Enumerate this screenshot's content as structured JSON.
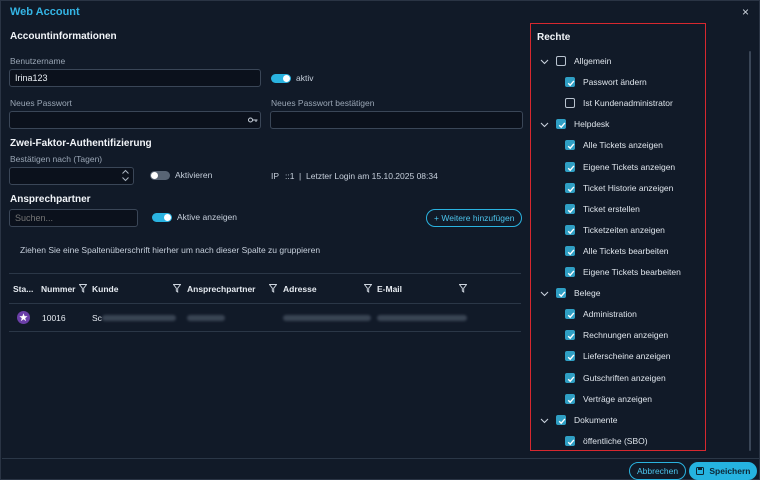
{
  "window": {
    "title": "Web Account",
    "close_glyph": "×"
  },
  "account": {
    "section_title": "Accountinformationen",
    "username_label": "Benutzername",
    "username_value": "Irina123",
    "active_label": "aktiv",
    "password_label": "Neues Passwort",
    "password_confirm_label": "Neues Passwort bestätigen"
  },
  "twofa": {
    "section_title": "Zwei-Faktor-Authentifizierung",
    "confirm_after_label": "Bestätigen nach (Tagen)",
    "activate_label": "Aktivieren",
    "ip_label": "IP",
    "ip_value": "::1",
    "separator": "|",
    "last_login": "Letzter Login am 15.10.2025 08:34"
  },
  "contacts": {
    "section_title": "Ansprechpartner",
    "search_placeholder": "Suchen...",
    "show_active_label": "Aktive anzeigen",
    "add_more_label": "Weitere hinzufügen",
    "add_icon": "+",
    "group_hint": "Ziehen Sie eine Spaltenüberschrift hierher um nach dieser Spalte zu gruppieren",
    "columns": [
      "Sta...",
      "Nummer",
      "Kunde",
      "Ansprechpartner",
      "Adresse",
      "E-Mail"
    ],
    "rows": [
      {
        "number": "10016",
        "customer_prefix": "Sc"
      }
    ]
  },
  "rights": {
    "title": "Rechte",
    "groups": [
      {
        "label": "Allgemein",
        "checked": false,
        "items": [
          {
            "label": "Passwort ändern",
            "checked": true
          },
          {
            "label": "Ist Kundenadministrator",
            "checked": false
          }
        ]
      },
      {
        "label": "Helpdesk",
        "checked": true,
        "items": [
          {
            "label": "Alle Tickets anzeigen",
            "checked": true
          },
          {
            "label": "Eigene Tickets anzeigen",
            "checked": true
          },
          {
            "label": "Ticket Historie anzeigen",
            "checked": true
          },
          {
            "label": "Ticket erstellen",
            "checked": true
          },
          {
            "label": "Ticketzeiten anzeigen",
            "checked": true
          },
          {
            "label": "Alle Tickets bearbeiten",
            "checked": true
          },
          {
            "label": "Eigene Tickets bearbeiten",
            "checked": true
          }
        ]
      },
      {
        "label": "Belege",
        "checked": true,
        "items": [
          {
            "label": "Administration",
            "checked": true
          },
          {
            "label": "Rechnungen anzeigen",
            "checked": true
          },
          {
            "label": "Lieferscheine anzeigen",
            "checked": true
          },
          {
            "label": "Gutschriften anzeigen",
            "checked": true
          },
          {
            "label": "Verträge anzeigen",
            "checked": true
          }
        ]
      },
      {
        "label": "Dokumente",
        "checked": true,
        "items": [
          {
            "label": "öffentliche (SBO)",
            "checked": true
          }
        ]
      }
    ]
  },
  "footer": {
    "cancel_label": "Abbrechen",
    "save_label": "Speichern"
  },
  "colors": {
    "accent": "#2ab3e0",
    "title": "#34b5e5",
    "highlight_border": "#d7282f",
    "checkbox": "#2f9fc4"
  }
}
